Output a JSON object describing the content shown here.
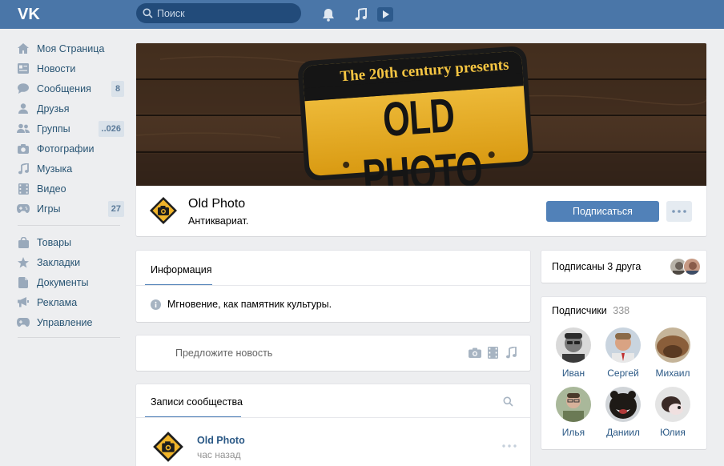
{
  "header": {
    "search_placeholder": "Поиск"
  },
  "sidebar": {
    "items": [
      {
        "label": "Моя Страница",
        "icon": "home-icon"
      },
      {
        "label": "Новости",
        "icon": "news-icon"
      },
      {
        "label": "Сообщения",
        "icon": "messages-icon",
        "count": "8"
      },
      {
        "label": "Друзья",
        "icon": "friends-icon"
      },
      {
        "label": "Группы",
        "icon": "groups-icon",
        "count": "..026"
      },
      {
        "label": "Фотографии",
        "icon": "camera-icon"
      },
      {
        "label": "Музыка",
        "icon": "music-icon"
      },
      {
        "label": "Видео",
        "icon": "video-icon"
      },
      {
        "label": "Игры",
        "icon": "games-icon",
        "count": "27"
      }
    ],
    "items2": [
      {
        "label": "Товары",
        "icon": "bag-icon"
      },
      {
        "label": "Закладки",
        "icon": "star-icon"
      },
      {
        "label": "Документы",
        "icon": "document-icon"
      },
      {
        "label": "Реклама",
        "icon": "megaphone-icon"
      },
      {
        "label": "Управление",
        "icon": "gamepad-icon"
      }
    ]
  },
  "cover": {
    "line1": "The 20th century presents",
    "line2": "OLD PHOTO"
  },
  "profile": {
    "name": "Old Photo",
    "status": "Антиквариат.",
    "subscribe": "Подписаться"
  },
  "info": {
    "tab": "Информация",
    "description": "Мгновение, как памятник культуры."
  },
  "suggest": {
    "placeholder": "Предложите новость"
  },
  "wall": {
    "tab": "Записи сообщества",
    "author": "Old Photo",
    "time": "час назад"
  },
  "friends": {
    "label": "Подписаны 3 друга"
  },
  "followers": {
    "title": "Подписчики",
    "count": "338",
    "members": [
      {
        "name": "Иван"
      },
      {
        "name": "Сергей"
      },
      {
        "name": "Михаил"
      },
      {
        "name": "Илья"
      },
      {
        "name": "Даниил"
      },
      {
        "name": "Юлия"
      }
    ]
  },
  "colors": {
    "header": "#4a76a8",
    "accent": "#5181b8",
    "link": "#2a5885"
  }
}
